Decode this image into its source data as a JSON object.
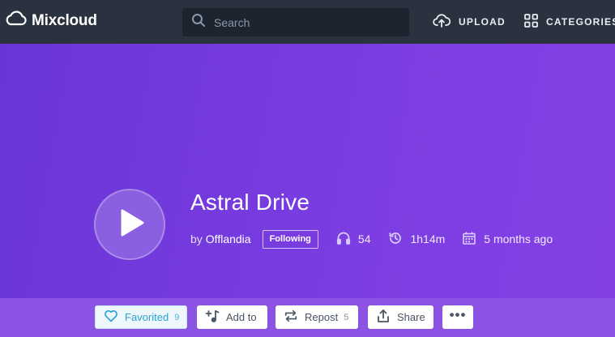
{
  "header": {
    "logo_text": "Mixcloud",
    "search_placeholder": "Search",
    "upload_label": "UPLOAD",
    "categories_label": "CATEGORIES"
  },
  "show": {
    "title": "Astral Drive",
    "by_label": "by",
    "artist": "Offlandia",
    "follow_label": "Following",
    "plays": "54",
    "duration": "1h14m",
    "uploaded": "5 months ago"
  },
  "actions": {
    "favorited_label": "Favorited",
    "favorited_count": "9",
    "add_to_label": "Add to",
    "repost_label": "Repost",
    "repost_count": "5",
    "share_label": "Share",
    "more_label": "•••"
  },
  "icons": {
    "logo": "cloud-icon",
    "search": "search-icon",
    "upload": "cloud-upload-icon",
    "categories": "grid-icon",
    "play": "play-icon",
    "plays": "headphones-icon",
    "duration": "history-icon",
    "date": "calendar-icon",
    "favorite": "heart-icon",
    "add_to": "playlist-add-icon",
    "repost": "repost-icon",
    "share": "share-icon"
  },
  "colors": {
    "topbar": "#2a3240",
    "hero_start": "#6935d7",
    "hero_end": "#8440e5",
    "action_bar": "#8b52e4",
    "favorited_accent": "#2aa3d4"
  }
}
